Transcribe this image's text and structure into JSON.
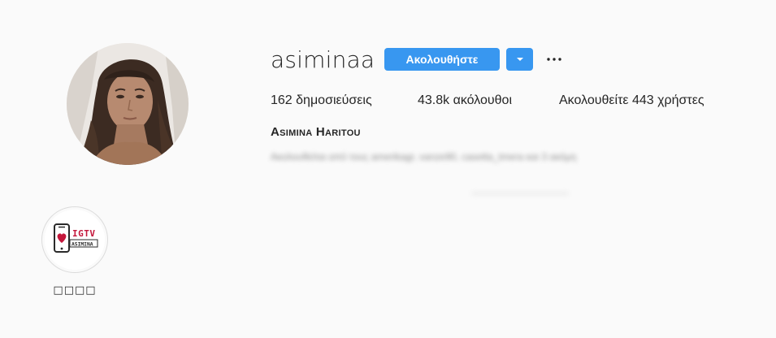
{
  "profile": {
    "username": "asiminaa",
    "follow_label": "Ακολουθήστε",
    "full_name": "Asimina Haritou",
    "followed_by": "Ακολουθείται από τους amerikagr, vanze90, casetta_tmera και 3 ακόμη"
  },
  "stats": {
    "posts": "162 δημοσιεύσεις",
    "followers": "43.8k ακόλουθοι",
    "following": "Ακολουθείτε 443 χρήστες"
  },
  "highlight": {
    "label": "□□□□",
    "image_text_top": "IGTV",
    "image_text_bottom": "ASIMINA"
  },
  "colors": {
    "accent": "#3897f0",
    "background": "#fafafa",
    "text": "#262626",
    "igtv_red": "#c4173b"
  },
  "icons": {
    "dropdown": "caret-down-icon",
    "more": "more-horizontal-icon"
  }
}
